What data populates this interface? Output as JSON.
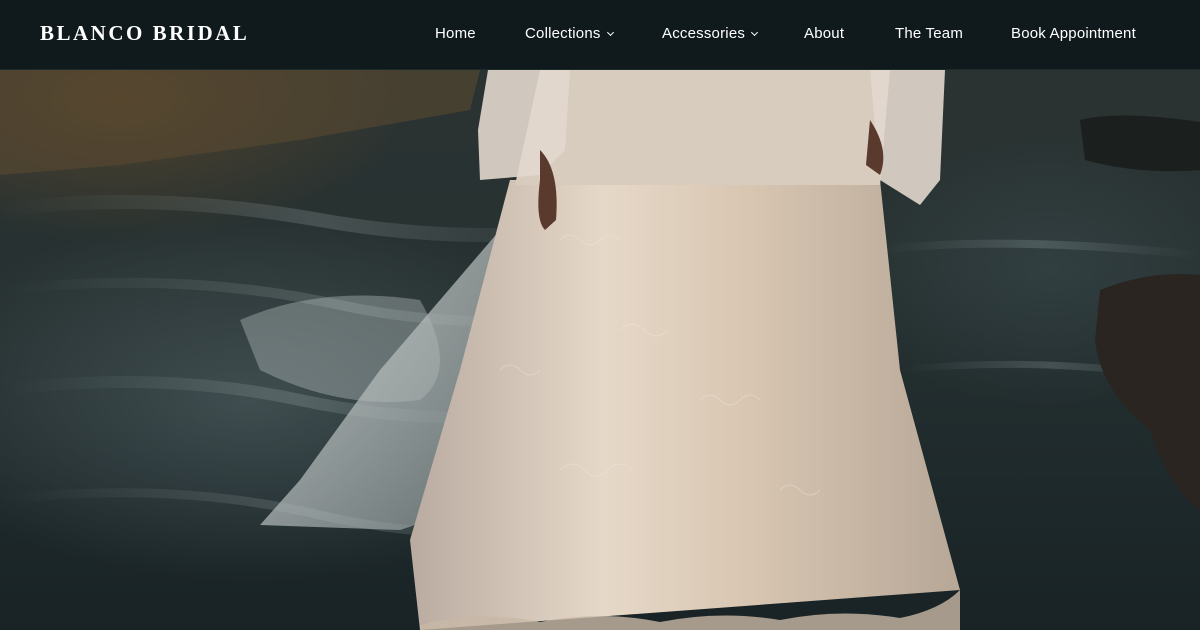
{
  "brand": {
    "name": "BLANCO BRIDAL"
  },
  "nav": {
    "items": [
      {
        "label": "Home",
        "has_dropdown": false
      },
      {
        "label": "Collections",
        "has_dropdown": true
      },
      {
        "label": "Accessories",
        "has_dropdown": true
      },
      {
        "label": "About",
        "has_dropdown": false
      },
      {
        "label": "The Team",
        "has_dropdown": false
      },
      {
        "label": "Book Appointment",
        "has_dropdown": false
      }
    ]
  },
  "hero": {
    "image_icon": "bride-lace-dress-at-shore-photo"
  },
  "colors": {
    "header_bg": "#101a1c",
    "nav_text": "#ffffff",
    "water": "#273131",
    "dress": "#e8ddd0"
  }
}
